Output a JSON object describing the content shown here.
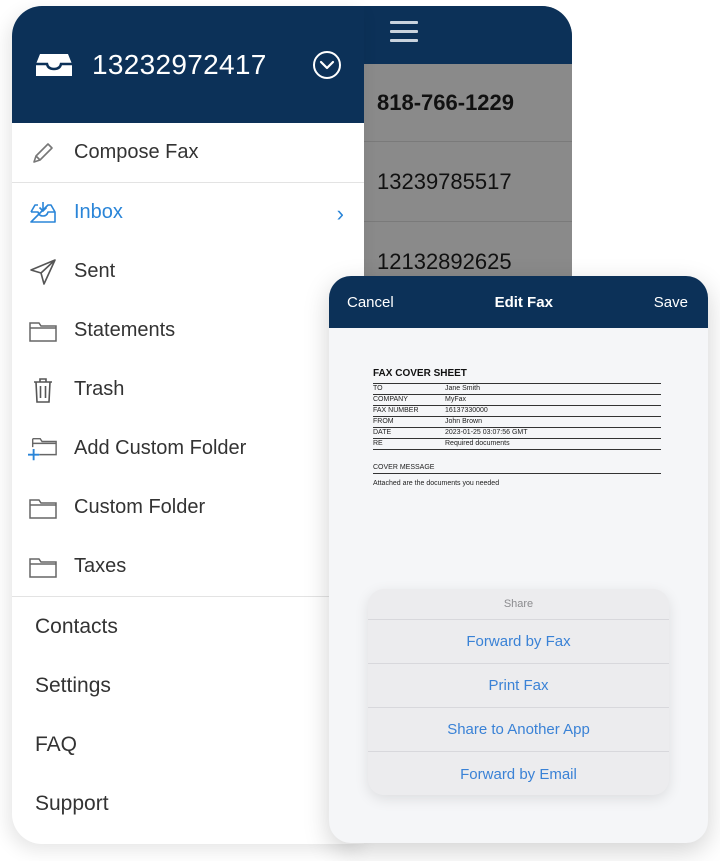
{
  "back_list": {
    "numbers": [
      "818-766-1229",
      "13239785517",
      "12132892625"
    ]
  },
  "menu": {
    "account_number": "13232972417",
    "compose_label": "Compose Fax",
    "folders": [
      {
        "label": "Inbox",
        "icon": "inbox-icon",
        "active": true
      },
      {
        "label": "Sent",
        "icon": "send-icon",
        "active": false
      },
      {
        "label": "Statements",
        "icon": "folder-icon",
        "active": false
      },
      {
        "label": "Trash",
        "icon": "trash-icon",
        "active": false
      },
      {
        "label": "Add Custom Folder",
        "icon": "folder-add-icon",
        "active": false
      },
      {
        "label": "Custom Folder",
        "icon": "folder-icon",
        "active": false
      },
      {
        "label": "Taxes",
        "icon": "folder-icon",
        "active": false
      }
    ],
    "links": [
      "Contacts",
      "Settings",
      "FAQ",
      "Support"
    ]
  },
  "edit_fax": {
    "cancel_label": "Cancel",
    "title": "Edit Fax",
    "save_label": "Save",
    "document": {
      "title": "FAX COVER SHEET",
      "rows": [
        {
          "key": "TO",
          "value": "Jane Smith"
        },
        {
          "key": "COMPANY",
          "value": "MyFax"
        },
        {
          "key": "FAX NUMBER",
          "value": "16137330000"
        },
        {
          "key": "FROM",
          "value": "John Brown"
        },
        {
          "key": "DATE",
          "value": "2023-01-25 03:07:56 GMT"
        },
        {
          "key": "RE",
          "value": "Required documents"
        }
      ],
      "cover_label": "COVER MESSAGE",
      "cover_text": "Attached are the documents you needed"
    },
    "share": {
      "title": "Share",
      "options": [
        "Forward by Fax",
        "Print Fax",
        "Share to Another App",
        "Forward by Email"
      ]
    }
  },
  "colors": {
    "header_navy": "#0c3158",
    "active_blue": "#2a85d8",
    "share_blue": "#3a82d6"
  }
}
